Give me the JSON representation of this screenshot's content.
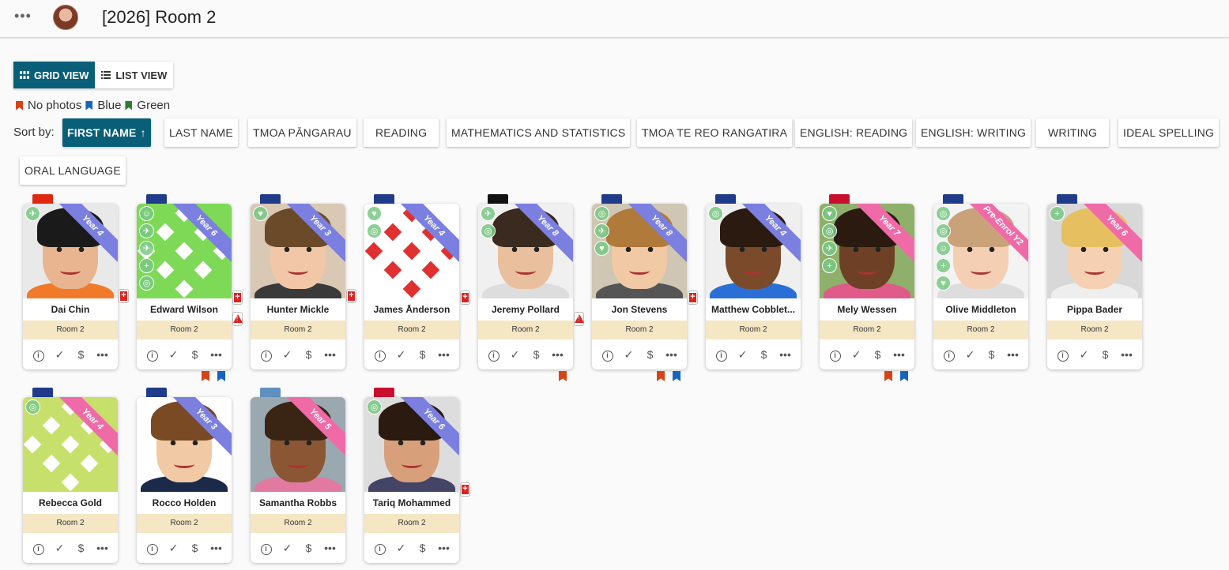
{
  "header": {
    "title": "[2026] Room 2",
    "menu_icon": "more-horizontal-icon"
  },
  "view": {
    "grid_label": "GRID VIEW",
    "list_label": "LIST VIEW",
    "active": "grid"
  },
  "legend": [
    {
      "label": "No photos",
      "color": "#d84315"
    },
    {
      "label": "Blue",
      "color": "#1565c0"
    },
    {
      "label": "Green",
      "color": "#2e7d32"
    }
  ],
  "sort": {
    "label": "Sort by:",
    "buttons": [
      "FIRST NAME",
      "LAST NAME",
      "TMOA PĀNGARAU",
      "READING",
      "MATHEMATICS AND STATISTICS",
      "TMOA TE REO RANGATIRA",
      "ENGLISH: READING",
      "ENGLISH: WRITING",
      "WRITING",
      "IDEAL SPELLING",
      "ORAL LANGUAGE"
    ],
    "active": "FIRST NAME",
    "direction_icon": "arrow-up-icon"
  },
  "students": [
    {
      "name": "Dai Chin",
      "room": "Room 2",
      "year": "Year 4",
      "ribbon": "#7b7fe0"
    },
    {
      "name": "Edward Wilson",
      "room": "Room 2",
      "year": "Year 6",
      "ribbon": "#7b7fe0"
    },
    {
      "name": "Hunter Mickle",
      "room": "Room 2",
      "year": "Year 3",
      "ribbon": "#7b7fe0"
    },
    {
      "name": "James Ānderson",
      "room": "Room 2",
      "year": "Year 4",
      "ribbon": "#7b7fe0"
    },
    {
      "name": "Jeremy Pollard",
      "room": "Room 2",
      "year": "Year 8",
      "ribbon": "#7b7fe0"
    },
    {
      "name": "Jon Stevens",
      "room": "Room 2",
      "year": "Year 8",
      "ribbon": "#7b7fe0"
    },
    {
      "name": "Matthew Cobblet...",
      "room": "Room 2",
      "year": "Year 4",
      "ribbon": "#7b7fe0"
    },
    {
      "name": "Mely Wessen",
      "room": "Room 2",
      "year": "Year 7",
      "ribbon": "#f06aa8"
    },
    {
      "name": "Olive Middleton",
      "room": "Room 2",
      "year": "Pre-Enrol Y2",
      "ribbon": "#f06aa8"
    },
    {
      "name": "Pippa Bader",
      "room": "Room 2",
      "year": "Year 6",
      "ribbon": "#f06aa8"
    },
    {
      "name": "Rebecca Gold",
      "room": "Room 2",
      "year": "Year 4",
      "ribbon": "#f06aa8"
    },
    {
      "name": "Rocco Holden",
      "room": "Room 2",
      "year": "Year 3",
      "ribbon": "#7b7fe0"
    },
    {
      "name": "Samantha Robbs",
      "room": "Room 2",
      "year": "Year 5",
      "ribbon": "#f06aa8"
    },
    {
      "name": "Tariq Mohammed",
      "room": "Room 2",
      "year": "Year 6",
      "ribbon": "#7b7fe0"
    }
  ],
  "card_actions": [
    "info-icon",
    "check-icon",
    "dollar-icon",
    "more-horizontal-icon"
  ]
}
